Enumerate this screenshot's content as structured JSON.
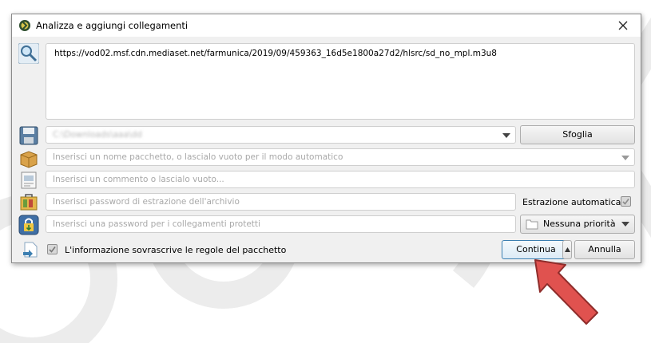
{
  "dialog": {
    "title": "Analizza e aggiungi collegamenti",
    "url_text": "https://vod02.msf.cdn.mediaset.net/farmunica/2019/09/459363_16d5e1800a27d2/hlsrc/sd_no_mpl.m3u8",
    "save_path_value": "C:\\Downloads\\aaa\\dd",
    "browse_label": "Sfoglia",
    "package_placeholder": "Inserisci un nome pacchetto, o lascialo vuoto per il modo automatico",
    "comment_placeholder": "Inserisci un commento o lascialo vuoto...",
    "archive_password_placeholder": "Inserisci password di estrazione dell'archivio",
    "auto_extract_label": "Estrazione automatica",
    "link_password_placeholder": "Inserisci una password per i collegamenti protetti",
    "priority_value": "Nessuna priorità",
    "overwrite_label": "L'informazione sovrascrive le regole del pacchetto",
    "continue_label": "Continua",
    "cancel_label": "Annulla"
  },
  "colors": {
    "dialog_bg": "#f0f0f0",
    "accent": "#3c7fb1",
    "arrow": "#e0524f"
  },
  "icons": [
    "jdownloader-logo-icon",
    "close-icon",
    "magnifier-icon",
    "floppy-disk-icon",
    "package-box-icon",
    "comment-note-icon",
    "archive-password-icon",
    "lock-download-icon",
    "file-arrow-icon",
    "folder-icon",
    "chevron-down-icon",
    "red-arrow-icon"
  ]
}
